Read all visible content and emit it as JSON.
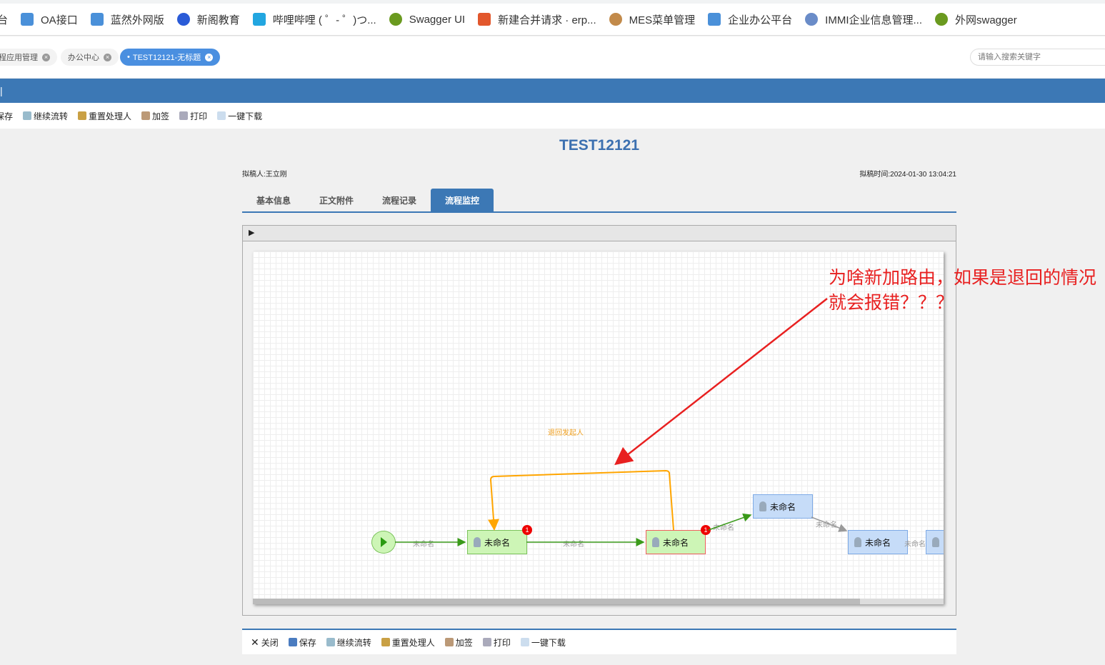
{
  "bookmarks": [
    {
      "label": "台",
      "icon": "page-icon"
    },
    {
      "label": "OA接口",
      "icon": "blue-square-icon"
    },
    {
      "label": "蓝然外网版",
      "icon": "blue-square-icon"
    },
    {
      "label": "新阁教育",
      "icon": "star-icon"
    },
    {
      "label": "哔哩哔哩 ( ゜- ゜)つ...",
      "icon": "bilibili-icon"
    },
    {
      "label": "Swagger UI",
      "icon": "swagger-icon"
    },
    {
      "label": "新建合并请求 · erp...",
      "icon": "gitlab-icon"
    },
    {
      "label": "MES菜单管理",
      "icon": "mes-icon"
    },
    {
      "label": "企业办公平台",
      "icon": "blue-square-icon"
    },
    {
      "label": "IMMI企业信息管理...",
      "icon": "globe-icon"
    },
    {
      "label": "外网swagger",
      "icon": "swagger-icon"
    }
  ],
  "page_tabs": [
    {
      "label": "程应用管理"
    },
    {
      "label": "办公中心"
    },
    {
      "label": "TEST12121-无标题"
    }
  ],
  "search": {
    "placeholder": "请输入搜索关键字"
  },
  "bluebar": {
    "label": "|"
  },
  "toolbar": [
    "保存",
    "继续流转",
    "重置处理人",
    "加签",
    "打印",
    "一键下载"
  ],
  "doc": {
    "title": "TEST12121",
    "drafter_label": "拟稿人:",
    "drafter": "王立刚",
    "time_label": "拟稿时间:",
    "time": "2024-01-30 13:04:21"
  },
  "doc_tabs": [
    "基本信息",
    "正文附件",
    "流程记录",
    "流程监控"
  ],
  "flow": {
    "nodes": [
      {
        "label": "未命名",
        "badge": "1"
      },
      {
        "label": "未命名",
        "badge": "1"
      },
      {
        "label": "未命名"
      },
      {
        "label": "未命名"
      },
      {
        "label": ""
      }
    ],
    "edge_labels": [
      "未命名",
      "未命名",
      "未命名",
      "未命名",
      "未命名"
    ],
    "return_label": "退回发起人"
  },
  "annotation": "为啥新加路由，如果是退回的情况就会报错？？？",
  "bottom_toolbar": [
    "关闭",
    "保存",
    "继续流转",
    "重置处理人",
    "加签",
    "打印",
    "一键下载"
  ],
  "colors": {
    "accent": "#3c78b5",
    "return_edge": "#ffa500",
    "annotation": "#e82020"
  }
}
